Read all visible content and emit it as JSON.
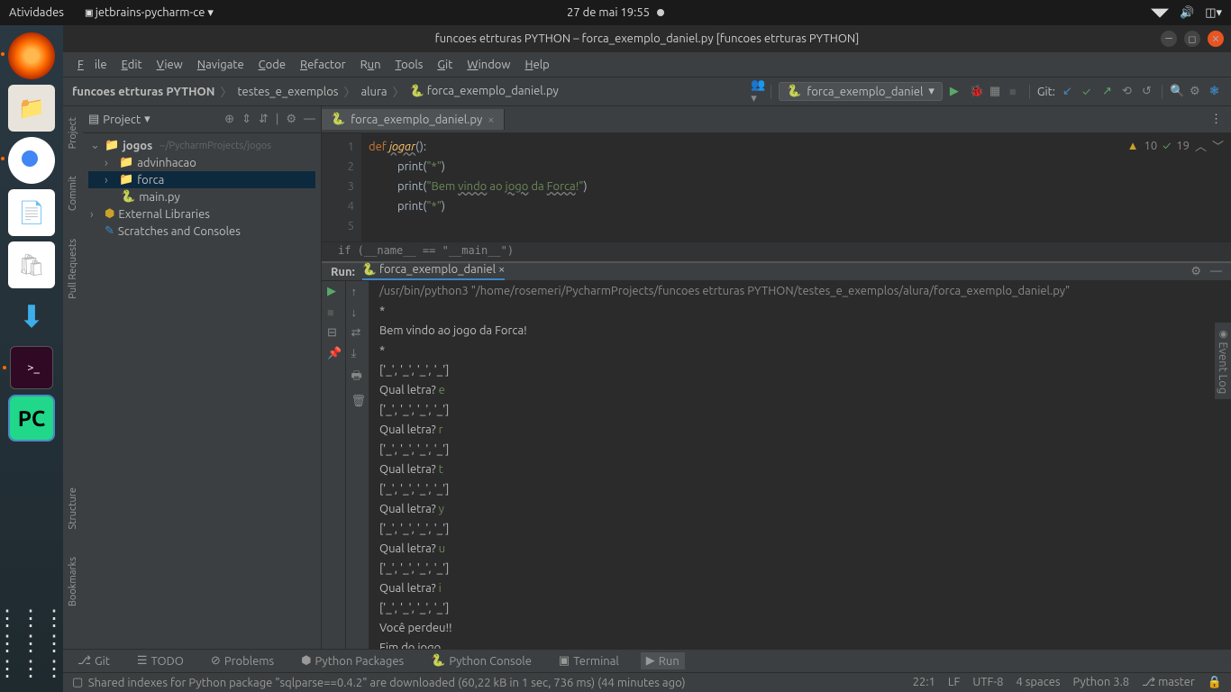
{
  "topbar": {
    "activities": "Atividades",
    "app": "jetbrains-pycharm-ce ▾",
    "datetime": "27 de mai  19:55"
  },
  "title": "funcoes etrturas PYTHON – forca_exemplo_daniel.py [funcoes etrturas PYTHON]",
  "menu": {
    "file": "File",
    "edit": "Edit",
    "view": "View",
    "navigate": "Navigate",
    "code": "Code",
    "refactor": "Refactor",
    "run": "Run",
    "tools": "Tools",
    "git": "Git",
    "window": "Window",
    "help": "Help"
  },
  "breadcrumb": {
    "p0": "funcoes etrturas PYTHON",
    "p1": "testes_e_exemplos",
    "p2": "alura",
    "p3": "forca_exemplo_daniel.py"
  },
  "runconfig": "forca_exemplo_daniel",
  "navbar": {
    "git": "Git:"
  },
  "project": {
    "label": "Project",
    "root": "jogos",
    "rootpath": "~/PycharmProjects/jogos",
    "f1": "advinhacao",
    "f2": "forca",
    "f3": "main.py",
    "ext": "External Libraries",
    "scratch": "Scratches and Consoles"
  },
  "editor": {
    "tab": "forca_exemplo_daniel.py",
    "lines": [
      "1",
      "2",
      "3",
      "4",
      "5"
    ],
    "c1a": "def ",
    "c1b": "jogar",
    "c1c": "():",
    "c2a": "print(",
    "c2b": "\"*\"",
    "c2c": ")",
    "c3a": "print(",
    "c3b": "\"Bem ",
    "c3c": "vindo",
    "c3d": " ao ",
    "c3e": "jogo",
    "c3f": " da ",
    "c3g": "Forca",
    "c3h": "!\"",
    "c3i": ")",
    "c4a": "print(",
    "c4b": "\"*\"",
    "c4c": ")",
    "crumb": "if (__name__ == \"__main__\")",
    "warn": "10",
    "ok": "19"
  },
  "run": {
    "label": "Run:",
    "name": "forca_exemplo_daniel",
    "l0": "/usr/bin/python3 \"/home/rosemeri/PycharmProjects/funcoes etrturas PYTHON/testes_e_exemplos/alura/forca_exemplo_daniel.py\"",
    "l1": "*",
    "l2": "Bem vindo ao jogo da Forca!",
    "l3": "*",
    "l4": "['_', '_', '_', '_']",
    "q": "Qual letra? ",
    "i1": "e",
    "i2": "r",
    "i3": "t",
    "i4": "y",
    "i5": "u",
    "i6": "i",
    "lose": "Você perdeu!!",
    "end": "Fim do jogo"
  },
  "bottom": {
    "git": "Git",
    "todo": "TODO",
    "problems": "Problems",
    "pkgs": "Python Packages",
    "console": "Python Console",
    "terminal": "Terminal",
    "run": "Run"
  },
  "status": {
    "msg": "Shared indexes for Python package \"sqlparse==0.4.2\" are downloaded (60,22 kB in 1 sec, 736 ms) (44 minutes ago)",
    "pos": "22:1",
    "lf": "LF",
    "enc": "UTF-8",
    "indent": "4 spaces",
    "py": "Python 3.8",
    "branch": "master"
  },
  "sidetools": {
    "project": "Project",
    "commit": "Commit",
    "pr": "Pull Requests",
    "structure": "Structure",
    "bookmarks": "Bookmarks"
  },
  "event_log": "Event Log"
}
